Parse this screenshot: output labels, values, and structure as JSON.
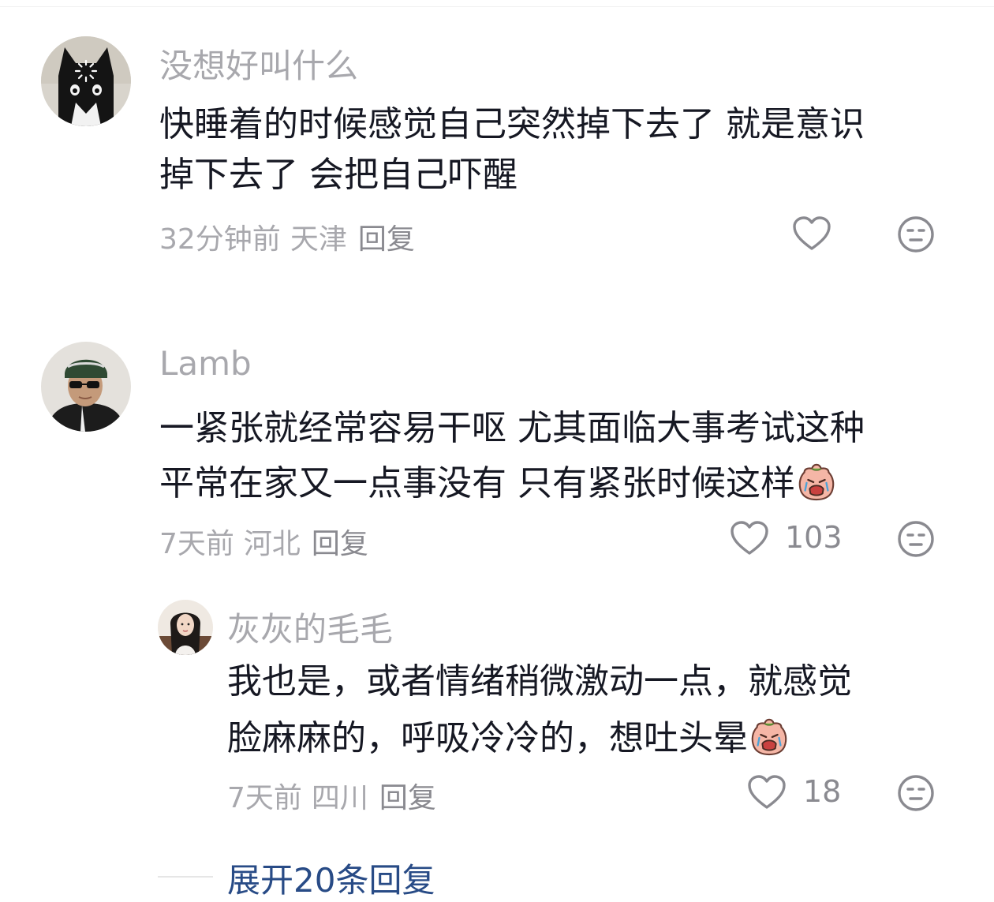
{
  "comments": [
    {
      "username": "没想好叫什么",
      "text_lines": [
        "快睡着的时候感觉自己突然掉下去了 就是意识",
        "掉下去了 会把自己吓醒"
      ],
      "time": "32分钟前",
      "location": "天津",
      "reply_label": "回复",
      "likes": "",
      "avatar_icon": "black-cat-avatar",
      "has_emoji": false
    },
    {
      "username": "Lamb",
      "text_lines": [
        "一紧张就经常容易干呕 尤其面临大事考试这种",
        "平常在家又一点事没有 只有紧张时候这样"
      ],
      "time": "7天前",
      "location": "河北",
      "reply_label": "回复",
      "likes": "103",
      "avatar_icon": "person-with-sunglasses-avatar",
      "has_emoji": true,
      "emoji_icon": "crying-face-emoji"
    }
  ],
  "reply": {
    "username": "灰灰的毛毛",
    "text_lines": [
      "我也是，或者情绪稍微激动一点，就感觉",
      "脸麻麻的，呼吸冷冷的，想吐头晕"
    ],
    "time": "7天前",
    "location": "四川",
    "reply_label": "回复",
    "likes": "18",
    "avatar_icon": "woman-long-hair-avatar",
    "has_emoji": true,
    "emoji_icon": "crying-face-emoji"
  },
  "expand_replies": {
    "label": "展开20条回复"
  },
  "colors": {
    "username": "#a8a8ad",
    "body_text": "#161823",
    "meta": "#a8a8ad",
    "expand_link": "#284b86",
    "icon_stroke": "#8a8a90"
  }
}
